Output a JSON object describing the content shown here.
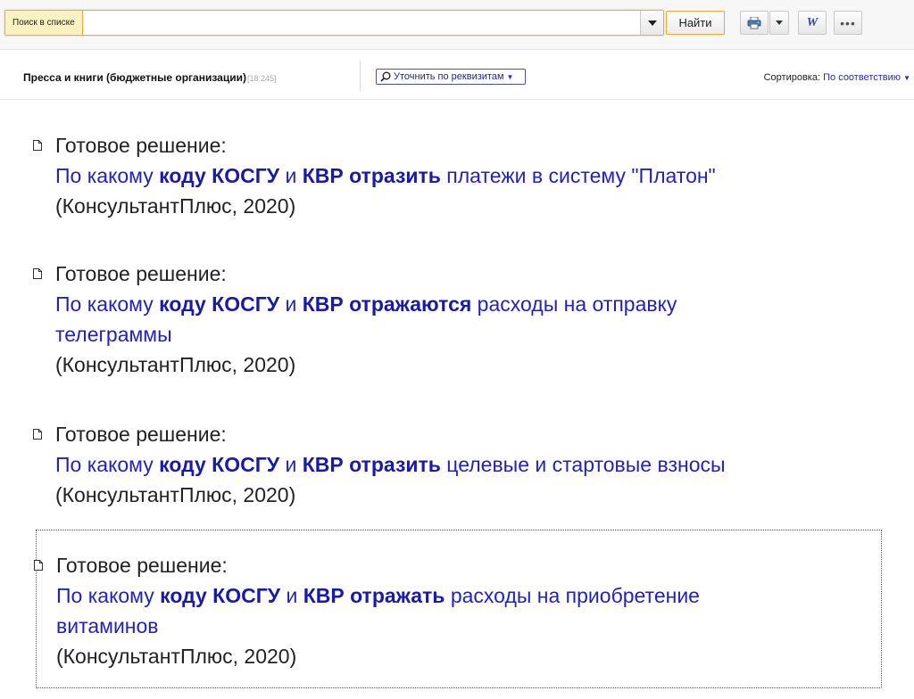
{
  "toolbar": {
    "search_label": "Поиск в списке",
    "search_value": "",
    "find_label": "Найти",
    "word_glyph": "W",
    "more_glyph": "•••"
  },
  "list": {
    "title": "Пресса и книги (бюджетные организации)",
    "count": "[18:245]",
    "refine_label": "Уточнить по реквизитам",
    "sort_label": "Сортировка:",
    "sort_value": "По соответствию"
  },
  "results": [
    {
      "type": "Готовое решение:",
      "link_line1": [
        {
          "t": "По какому ",
          "b": false
        },
        {
          "t": "коду КОСГУ",
          "b": true
        },
        {
          "t": " и ",
          "b": false
        },
        {
          "t": "КВР отразить",
          "b": true
        },
        {
          "t": " платежи в систему \"Платон\"",
          "b": false
        }
      ],
      "link_line2": [],
      "source": "(КонсультантПлюс, 2020)"
    },
    {
      "type": "Готовое решение:",
      "link_line1": [
        {
          "t": "По какому ",
          "b": false
        },
        {
          "t": "коду КОСГУ",
          "b": true
        },
        {
          "t": " и ",
          "b": false
        },
        {
          "t": "КВР отражаются",
          "b": true
        },
        {
          "t": " расходы на отправку",
          "b": false
        }
      ],
      "link_line2": [
        {
          "t": "телеграммы",
          "b": false
        }
      ],
      "source": "(КонсультантПлюс, 2020)"
    },
    {
      "type": "Готовое решение:",
      "link_line1": [
        {
          "t": "По какому ",
          "b": false
        },
        {
          "t": "коду КОСГУ",
          "b": true
        },
        {
          "t": " и ",
          "b": false
        },
        {
          "t": "КВР отразить",
          "b": true
        },
        {
          "t": " целевые и стартовые взносы",
          "b": false
        }
      ],
      "link_line2": [],
      "source": "(КонсультантПлюс, 2020)"
    },
    {
      "type": "Готовое решение:",
      "link_line1": [
        {
          "t": "По какому ",
          "b": false
        },
        {
          "t": "коду КОСГУ",
          "b": true
        },
        {
          "t": " и ",
          "b": false
        },
        {
          "t": "КВР отражать",
          "b": true
        },
        {
          "t": " расходы на приобретение",
          "b": false
        }
      ],
      "link_line2": [
        {
          "t": "витаминов",
          "b": false
        }
      ],
      "source": "(КонсультантПлюс, 2020)"
    }
  ]
}
